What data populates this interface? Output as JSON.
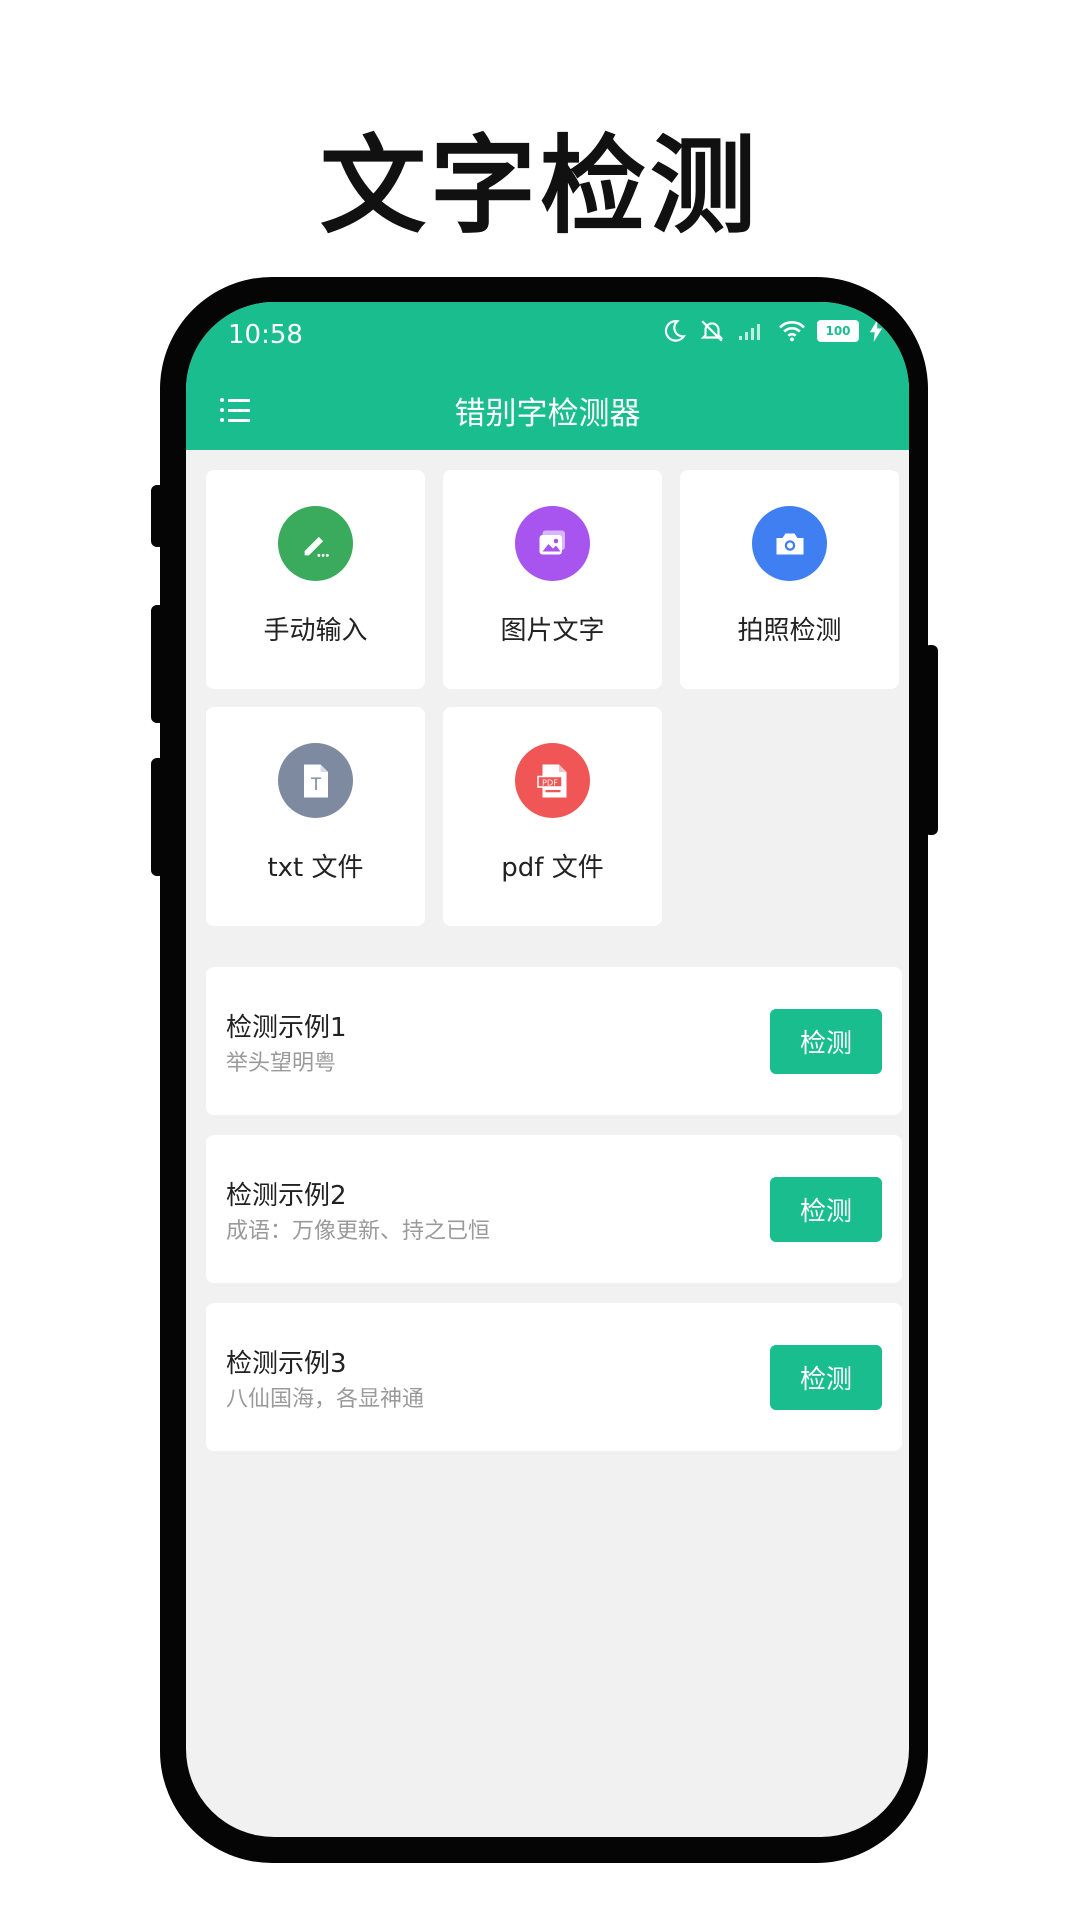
{
  "promo": {
    "title": "文字检测"
  },
  "status": {
    "time": "10:58",
    "battery": "100"
  },
  "appbar": {
    "title": "错别字检测器"
  },
  "tiles": [
    {
      "label": "手动输入",
      "icon": "pencil-icon",
      "color": "#3aaa5c"
    },
    {
      "label": "图片文字",
      "icon": "image-icon",
      "color": "#a855f0"
    },
    {
      "label": "拍照检测",
      "icon": "camera-icon",
      "color": "#3f7ff2"
    },
    {
      "label": "txt 文件",
      "icon": "txt-file-icon",
      "color": "#7d8a9f"
    },
    {
      "label": "pdf 文件",
      "icon": "pdf-file-icon",
      "color": "#f05656"
    }
  ],
  "examples": [
    {
      "title": "检测示例1",
      "text": "举头望明粤",
      "button": "检测"
    },
    {
      "title": "检测示例2",
      "text": "成语：万像更新、持之已恒",
      "button": "检测"
    },
    {
      "title": "检测示例3",
      "text": "八仙国海，各显神通",
      "button": "检测"
    }
  ],
  "colors": {
    "primary": "#1abd8e",
    "background": "#f1f1f1"
  }
}
